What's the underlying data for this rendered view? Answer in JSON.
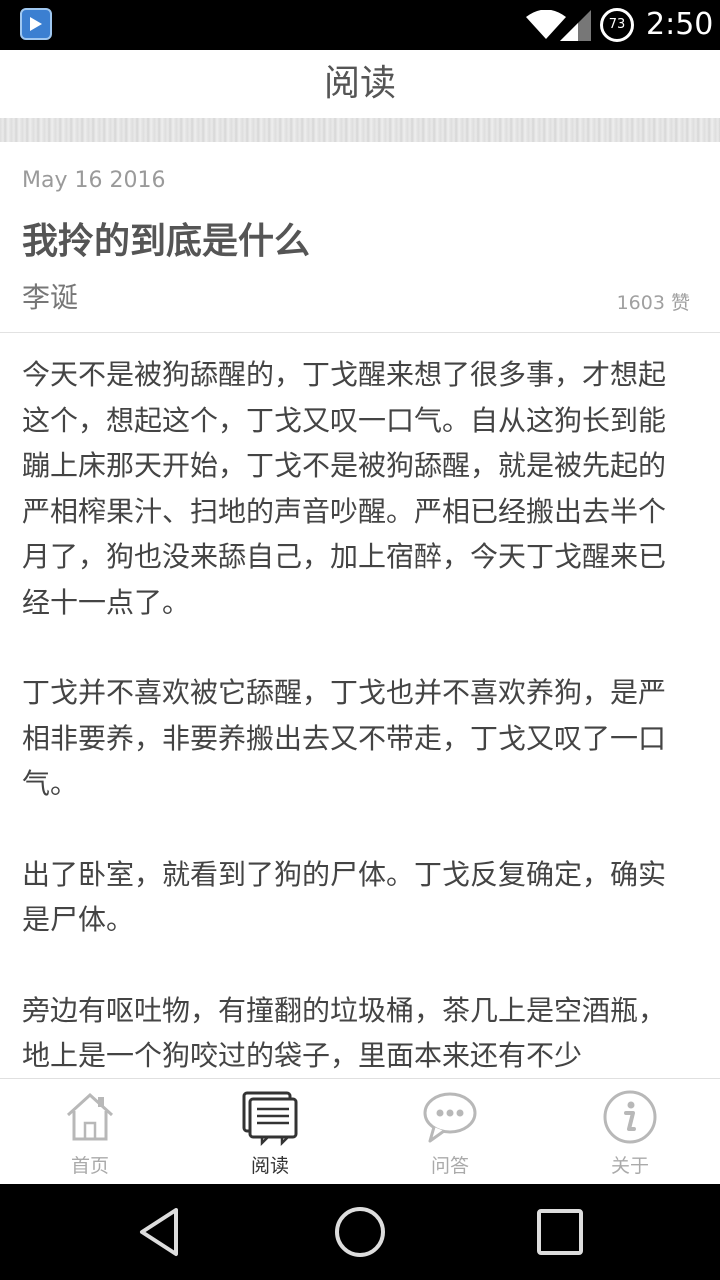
{
  "status_bar": {
    "battery_level": "73",
    "time": "2:50",
    "icons": [
      "app-icon",
      "wifi-icon",
      "signal-icon",
      "battery-icon"
    ]
  },
  "header": {
    "title": "阅读"
  },
  "article": {
    "date": "May 16 2016",
    "title": "我拎的到底是什么",
    "author": "李诞",
    "likes": "1603 赞",
    "paragraphs": [
      "今天不是被狗舔醒的，丁戈醒来想了很多事，才想起这个，想起这个，丁戈又叹一口气。自从这狗长到能蹦上床那天开始，丁戈不是被狗舔醒，就是被先起的严相榨果汁、扫地的声音吵醒。严相已经搬出去半个月了，狗也没来舔自己，加上宿醉，今天丁戈醒来已经十一点了。",
      "丁戈并不喜欢被它舔醒，丁戈也并不喜欢养狗，是严相非要养，非要养搬出去又不带走，丁戈又叹了一口气。",
      "出了卧室，就看到了狗的尸体。丁戈反复确定，确实是尸体。",
      "旁边有呕吐物，有撞翻的垃圾桶，茶几上是空酒瓶，地上是一个狗咬过的袋子，里面本来还有不少"
    ]
  },
  "bottom_nav": {
    "items": [
      {
        "label": "首页",
        "icon": "home-icon",
        "active": false
      },
      {
        "label": "阅读",
        "icon": "reading-icon",
        "active": true
      },
      {
        "label": "问答",
        "icon": "chat-bubble-icon",
        "active": false
      },
      {
        "label": "关于",
        "icon": "info-icon",
        "active": false
      }
    ]
  },
  "colors": {
    "active": "#333333",
    "inactive": "#aaaaaa",
    "icon_gray": "#b8b8b8"
  }
}
